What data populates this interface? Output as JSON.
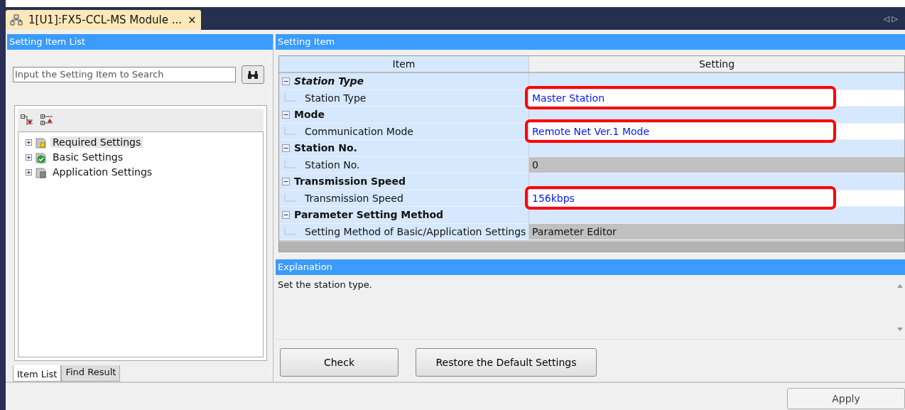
{
  "document_tab": {
    "title": "1[U1]:FX5-CCL-MS Module ...",
    "close": "×"
  },
  "nav_arrows": "◁ ▷",
  "left_panel": {
    "title": "Setting Item List",
    "search": {
      "placeholder": "Input the Setting Item to Search"
    },
    "tree": [
      {
        "label": "Required Settings",
        "kind": "required",
        "selected": true
      },
      {
        "label": "Basic Settings",
        "kind": "basic",
        "selected": false
      },
      {
        "label": "Application Settings",
        "kind": "application",
        "selected": false
      }
    ],
    "tabs": [
      {
        "label": "Item List",
        "selected": true
      },
      {
        "label": "Find Result",
        "selected": false
      }
    ]
  },
  "setting_item": {
    "title": "Setting Item",
    "columns": [
      "Item",
      "Setting"
    ],
    "rows": [
      {
        "kind": "group",
        "label": "Station Type",
        "italic": true
      },
      {
        "kind": "item",
        "label": "Station Type",
        "value": "Master Station",
        "editable": true,
        "highlighted": true
      },
      {
        "kind": "group",
        "label": "Mode",
        "italic": false
      },
      {
        "kind": "item",
        "label": "Communication Mode",
        "value": "Remote Net Ver.1 Mode",
        "editable": true,
        "highlighted": true
      },
      {
        "kind": "group",
        "label": "Station No.",
        "italic": false
      },
      {
        "kind": "item",
        "label": "Station No.",
        "value": "0",
        "editable": false,
        "highlighted": false
      },
      {
        "kind": "group",
        "label": "Transmission Speed",
        "italic": false
      },
      {
        "kind": "item",
        "label": "Transmission Speed",
        "value": "156kbps",
        "editable": true,
        "highlighted": true
      },
      {
        "kind": "group",
        "label": "Parameter Setting Method",
        "italic": false
      },
      {
        "kind": "item",
        "label": "Setting Method of Basic/Application Settings",
        "value": "Parameter Editor",
        "editable": false,
        "highlighted": false
      }
    ]
  },
  "explanation": {
    "title": "Explanation",
    "text": "Set the station type."
  },
  "buttons": [
    "Check",
    "Restore the Default Settings"
  ],
  "apply_button": "Apply"
}
